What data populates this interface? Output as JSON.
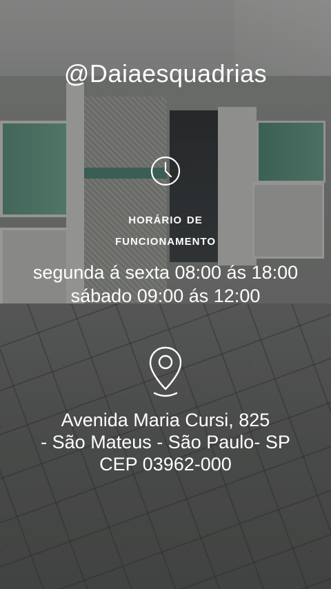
{
  "profile": {
    "handle": "@Daiaesquadrias"
  },
  "hours": {
    "icon": "clock-icon",
    "title_line1": "HORÁRIO DE",
    "title_line2": "FUNCIONAMENTO",
    "weekdays": "segunda á sexta  08:00 ás 18:00",
    "saturday": "sábado 09:00 ás 12:00"
  },
  "address": {
    "icon": "location-pin-icon",
    "line1": "Avenida Maria Cursi, 825",
    "line2": "- São Mateus - São Paulo- SP",
    "line3": "CEP 03962-000"
  },
  "colors": {
    "text": "#ffffff",
    "accent_green": "#5d9a84"
  }
}
